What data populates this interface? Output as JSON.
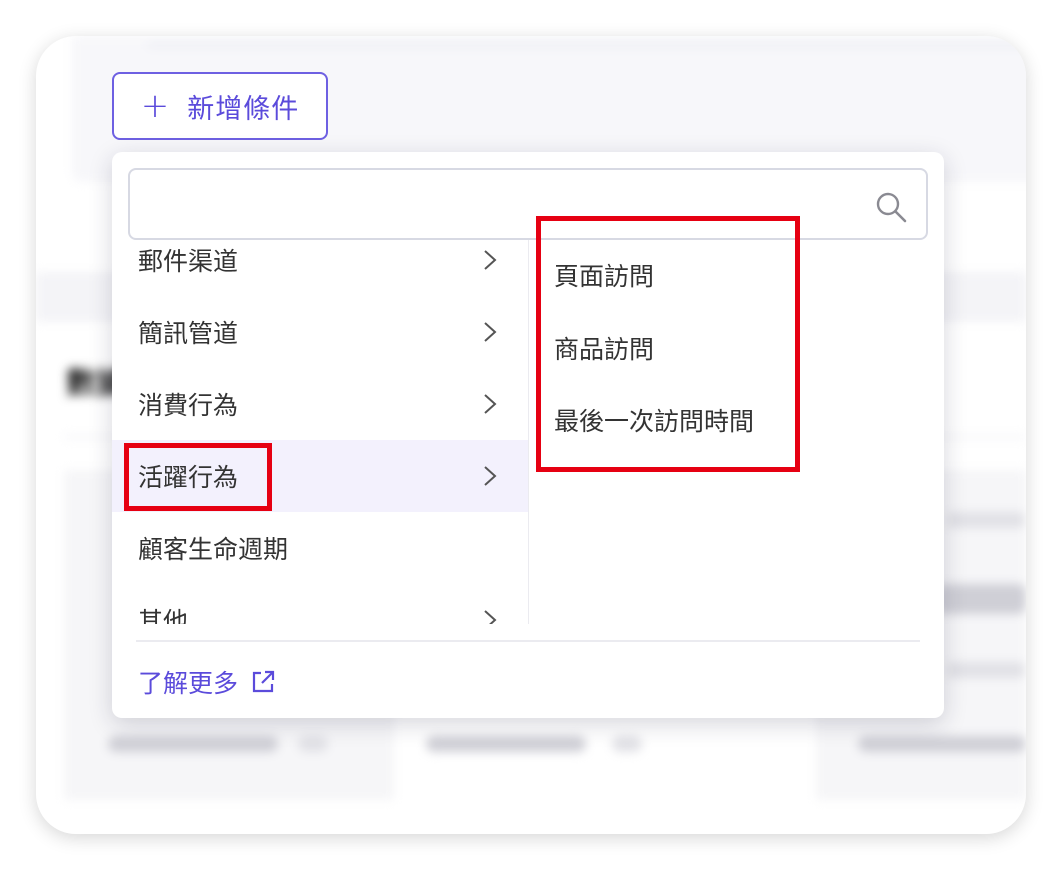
{
  "add_condition": {
    "plus": "+",
    "label": "新增條件"
  },
  "search": {
    "placeholder": "",
    "value": ""
  },
  "categories": [
    {
      "label": "郵件渠道",
      "has_submenu": true
    },
    {
      "label": "簡訊管道",
      "has_submenu": true
    },
    {
      "label": "消費行為",
      "has_submenu": true
    },
    {
      "label": "活躍行為",
      "has_submenu": true,
      "selected": true
    },
    {
      "label": "顧客生命週期",
      "has_submenu": false
    },
    {
      "label": "其他",
      "has_submenu": true
    }
  ],
  "submenu": {
    "items": [
      {
        "label": "頁面訪問"
      },
      {
        "label": "商品訪問"
      },
      {
        "label": "最後一次訪問時間"
      }
    ]
  },
  "learn_more": {
    "label": "了解更多",
    "icon": "external-link-icon"
  },
  "background": {
    "section_title": "數據"
  },
  "colors": {
    "accent": "#5b4bdb",
    "highlight": "#e60012",
    "active_row": "#f3f1fd"
  }
}
